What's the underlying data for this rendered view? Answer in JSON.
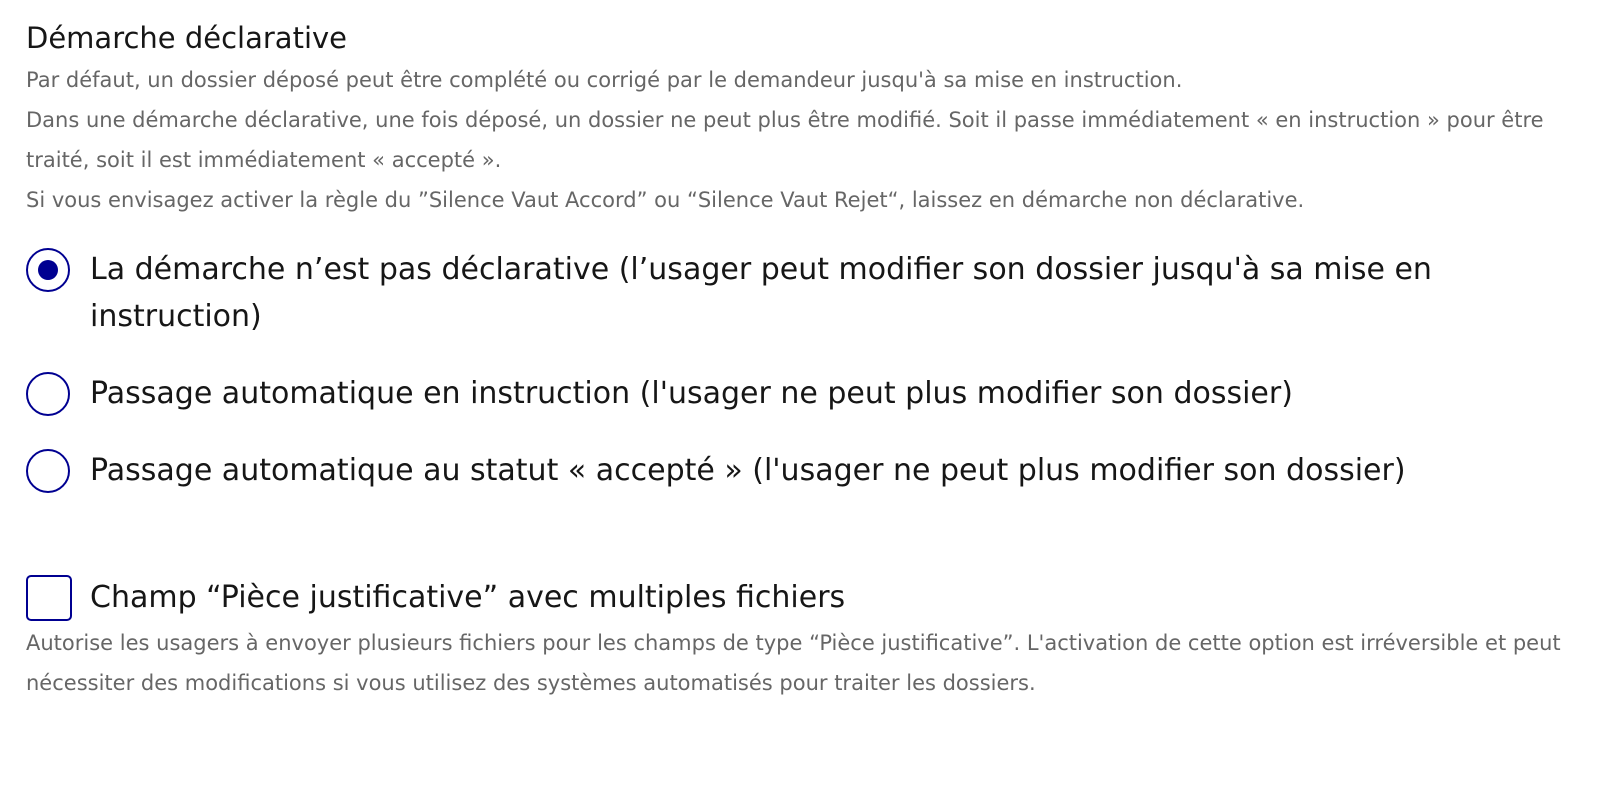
{
  "declarative": {
    "title": "Démarche déclarative",
    "hints": [
      "Par défaut, un dossier déposé peut être complété ou corrigé par le demandeur jusqu'à sa mise en instruction.",
      "Dans une démarche déclarative, une fois déposé, un dossier ne peut plus être modifié. Soit il passe immédiatement « en instruction » pour être traité, soit il est immédiatement « accepté ».",
      "Si vous envisagez activer la règle du ”Silence Vaut Accord” ou “Silence Vaut Rejet“, laissez en démarche non déclarative."
    ],
    "options": [
      {
        "label": "La démarche n’est pas déclarative (l’usager peut modifier son dossier jusqu'à sa mise en instruction)",
        "checked": true
      },
      {
        "label": "Passage automatique en instruction (l'usager ne peut plus modifier son dossier)",
        "checked": false
      },
      {
        "label": "Passage automatique au statut « accepté » (l'usager ne peut plus modifier son dossier)",
        "checked": false
      }
    ]
  },
  "multiple_files": {
    "label": "Champ “Pièce justificative” avec multiples fichiers",
    "checked": false,
    "hint": "Autorise les usagers à envoyer plusieurs fichiers pour les champs de type “Pièce justificative”. L'activation de cette option est irréversible et peut nécessiter des modifications si vous utilisez des systèmes automatisés pour traiter les dossiers."
  },
  "colors": {
    "accent": "#000091",
    "text": "#161616",
    "hint": "#666666"
  }
}
